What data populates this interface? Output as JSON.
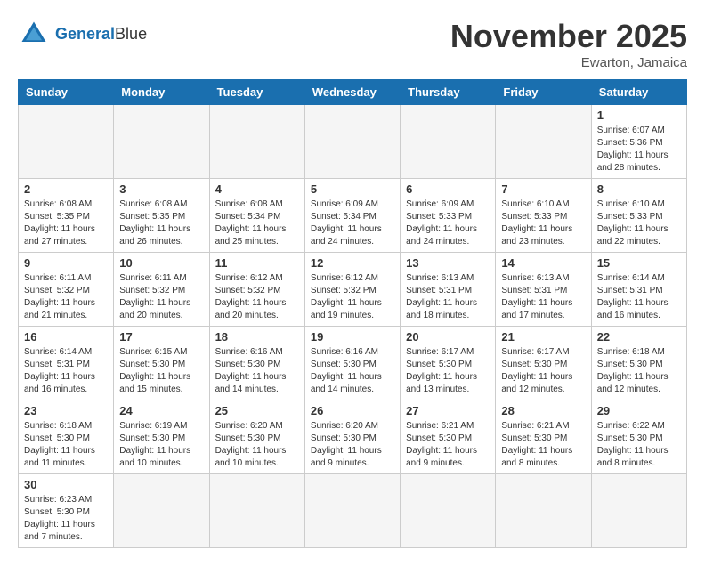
{
  "header": {
    "logo_general": "General",
    "logo_blue": "Blue",
    "month_title": "November 2025",
    "location": "Ewarton, Jamaica"
  },
  "days_of_week": [
    "Sunday",
    "Monday",
    "Tuesday",
    "Wednesday",
    "Thursday",
    "Friday",
    "Saturday"
  ],
  "weeks": [
    [
      {
        "day": "",
        "info": ""
      },
      {
        "day": "",
        "info": ""
      },
      {
        "day": "",
        "info": ""
      },
      {
        "day": "",
        "info": ""
      },
      {
        "day": "",
        "info": ""
      },
      {
        "day": "",
        "info": ""
      },
      {
        "day": "1",
        "info": "Sunrise: 6:07 AM\nSunset: 5:36 PM\nDaylight: 11 hours\nand 28 minutes."
      }
    ],
    [
      {
        "day": "2",
        "info": "Sunrise: 6:08 AM\nSunset: 5:35 PM\nDaylight: 11 hours\nand 27 minutes."
      },
      {
        "day": "3",
        "info": "Sunrise: 6:08 AM\nSunset: 5:35 PM\nDaylight: 11 hours\nand 26 minutes."
      },
      {
        "day": "4",
        "info": "Sunrise: 6:08 AM\nSunset: 5:34 PM\nDaylight: 11 hours\nand 25 minutes."
      },
      {
        "day": "5",
        "info": "Sunrise: 6:09 AM\nSunset: 5:34 PM\nDaylight: 11 hours\nand 24 minutes."
      },
      {
        "day": "6",
        "info": "Sunrise: 6:09 AM\nSunset: 5:33 PM\nDaylight: 11 hours\nand 24 minutes."
      },
      {
        "day": "7",
        "info": "Sunrise: 6:10 AM\nSunset: 5:33 PM\nDaylight: 11 hours\nand 23 minutes."
      },
      {
        "day": "8",
        "info": "Sunrise: 6:10 AM\nSunset: 5:33 PM\nDaylight: 11 hours\nand 22 minutes."
      }
    ],
    [
      {
        "day": "9",
        "info": "Sunrise: 6:11 AM\nSunset: 5:32 PM\nDaylight: 11 hours\nand 21 minutes."
      },
      {
        "day": "10",
        "info": "Sunrise: 6:11 AM\nSunset: 5:32 PM\nDaylight: 11 hours\nand 20 minutes."
      },
      {
        "day": "11",
        "info": "Sunrise: 6:12 AM\nSunset: 5:32 PM\nDaylight: 11 hours\nand 20 minutes."
      },
      {
        "day": "12",
        "info": "Sunrise: 6:12 AM\nSunset: 5:32 PM\nDaylight: 11 hours\nand 19 minutes."
      },
      {
        "day": "13",
        "info": "Sunrise: 6:13 AM\nSunset: 5:31 PM\nDaylight: 11 hours\nand 18 minutes."
      },
      {
        "day": "14",
        "info": "Sunrise: 6:13 AM\nSunset: 5:31 PM\nDaylight: 11 hours\nand 17 minutes."
      },
      {
        "day": "15",
        "info": "Sunrise: 6:14 AM\nSunset: 5:31 PM\nDaylight: 11 hours\nand 16 minutes."
      }
    ],
    [
      {
        "day": "16",
        "info": "Sunrise: 6:14 AM\nSunset: 5:31 PM\nDaylight: 11 hours\nand 16 minutes."
      },
      {
        "day": "17",
        "info": "Sunrise: 6:15 AM\nSunset: 5:30 PM\nDaylight: 11 hours\nand 15 minutes."
      },
      {
        "day": "18",
        "info": "Sunrise: 6:16 AM\nSunset: 5:30 PM\nDaylight: 11 hours\nand 14 minutes."
      },
      {
        "day": "19",
        "info": "Sunrise: 6:16 AM\nSunset: 5:30 PM\nDaylight: 11 hours\nand 14 minutes."
      },
      {
        "day": "20",
        "info": "Sunrise: 6:17 AM\nSunset: 5:30 PM\nDaylight: 11 hours\nand 13 minutes."
      },
      {
        "day": "21",
        "info": "Sunrise: 6:17 AM\nSunset: 5:30 PM\nDaylight: 11 hours\nand 12 minutes."
      },
      {
        "day": "22",
        "info": "Sunrise: 6:18 AM\nSunset: 5:30 PM\nDaylight: 11 hours\nand 12 minutes."
      }
    ],
    [
      {
        "day": "23",
        "info": "Sunrise: 6:18 AM\nSunset: 5:30 PM\nDaylight: 11 hours\nand 11 minutes."
      },
      {
        "day": "24",
        "info": "Sunrise: 6:19 AM\nSunset: 5:30 PM\nDaylight: 11 hours\nand 10 minutes."
      },
      {
        "day": "25",
        "info": "Sunrise: 6:20 AM\nSunset: 5:30 PM\nDaylight: 11 hours\nand 10 minutes."
      },
      {
        "day": "26",
        "info": "Sunrise: 6:20 AM\nSunset: 5:30 PM\nDaylight: 11 hours\nand 9 minutes."
      },
      {
        "day": "27",
        "info": "Sunrise: 6:21 AM\nSunset: 5:30 PM\nDaylight: 11 hours\nand 9 minutes."
      },
      {
        "day": "28",
        "info": "Sunrise: 6:21 AM\nSunset: 5:30 PM\nDaylight: 11 hours\nand 8 minutes."
      },
      {
        "day": "29",
        "info": "Sunrise: 6:22 AM\nSunset: 5:30 PM\nDaylight: 11 hours\nand 8 minutes."
      }
    ],
    [
      {
        "day": "30",
        "info": "Sunrise: 6:23 AM\nSunset: 5:30 PM\nDaylight: 11 hours\nand 7 minutes."
      },
      {
        "day": "",
        "info": ""
      },
      {
        "day": "",
        "info": ""
      },
      {
        "day": "",
        "info": ""
      },
      {
        "day": "",
        "info": ""
      },
      {
        "day": "",
        "info": ""
      },
      {
        "day": "",
        "info": ""
      }
    ]
  ]
}
